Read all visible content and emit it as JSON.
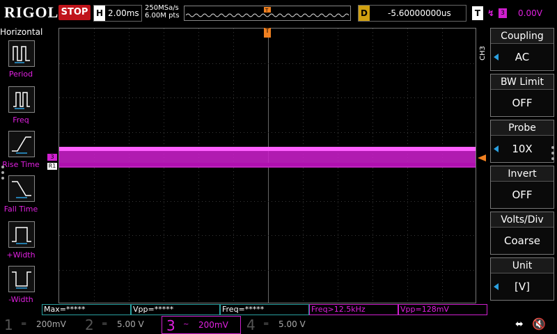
{
  "topbar": {
    "brand": "RIGOL",
    "run_state": "STOP",
    "horizontal_label": "H",
    "timebase": "2.00ms",
    "sample_rate": "250MSa/s",
    "memory_depth": "6.00M pts",
    "trigger_marker": "T",
    "delay_label": "D",
    "delay_value": "-5.60000000us",
    "trigger_label": "T",
    "trigger_edge": "↯",
    "trigger_source": "3",
    "trigger_level": "0.00V"
  },
  "left_menu": {
    "title": "Horizontal",
    "items": [
      {
        "label": "Period",
        "icon": "period-icon"
      },
      {
        "label": "Freq",
        "icon": "frequency-icon"
      },
      {
        "label": "Rise Time",
        "icon": "rise-time-icon"
      },
      {
        "label": "Fall Time",
        "icon": "fall-time-icon"
      },
      {
        "label": "+Width",
        "icon": "positive-width-icon"
      },
      {
        "label": "-Width",
        "icon": "negative-width-icon"
      }
    ]
  },
  "waveform": {
    "channel_marker": "3",
    "ref_marker": "R1",
    "color": "#d020d0"
  },
  "right_menu": {
    "channel_tag": "CH3",
    "items": [
      {
        "title": "Coupling",
        "value": "AC"
      },
      {
        "title": "BW Limit",
        "value": "OFF"
      },
      {
        "title": "Probe",
        "value": "10X"
      },
      {
        "title": "Invert",
        "value": "OFF"
      },
      {
        "title": "Volts/Div",
        "value": "Coarse"
      },
      {
        "title": "Unit",
        "value": "[V]"
      }
    ]
  },
  "measurements": [
    {
      "text": "Max=*****",
      "color": "#2aa0a0"
    },
    {
      "text": "Vpp=*****",
      "color": "#2aa0a0"
    },
    {
      "text": "Freq=*****",
      "color": "#2aa0a0"
    },
    {
      "text": "Freq>12.5kHz",
      "color": "#e020e0"
    },
    {
      "text": "Vpp=128mV",
      "color": "#e020e0"
    }
  ],
  "channels": [
    {
      "num": "1",
      "coupling": "=",
      "scale": "200mV"
    },
    {
      "num": "2",
      "coupling": "=",
      "scale": "5.00 V"
    },
    {
      "num": "3",
      "coupling": "~",
      "scale": "200mV"
    },
    {
      "num": "4",
      "coupling": "=",
      "scale": "5.00 V"
    }
  ],
  "status": {
    "usb": "⬌",
    "speaker": "🔇"
  }
}
